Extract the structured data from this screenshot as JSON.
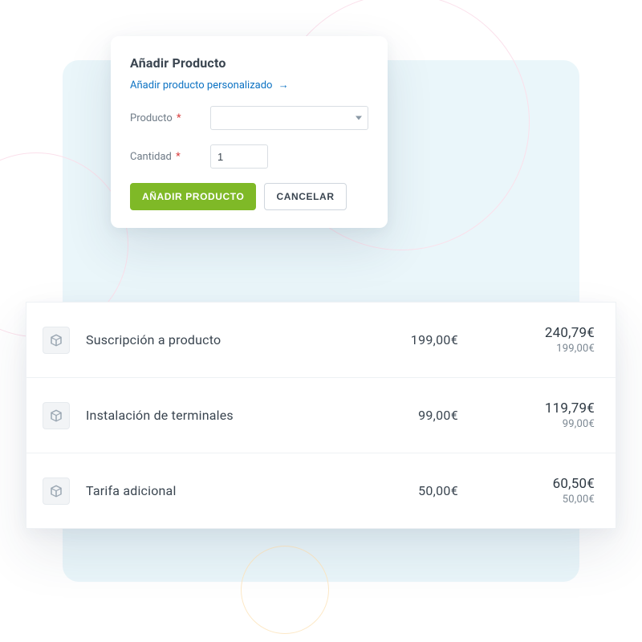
{
  "modal": {
    "title": "Añadir Producto",
    "link_text": "Añadir producto personalizado",
    "link_arrow": "→",
    "product_label": "Producto",
    "quantity_label": "Cantidad",
    "required_mark": "*",
    "product_value": "",
    "quantity_value": "1",
    "submit_label": "Añadir Producto",
    "cancel_label": "Cancelar"
  },
  "products": [
    {
      "name": "Suscripción a producto",
      "unit_price": "199,00€",
      "total": "240,79€",
      "sub": "199,00€"
    },
    {
      "name": "Instalación de terminales",
      "unit_price": "99,00€",
      "total": "119,79€",
      "sub": "99,00€"
    },
    {
      "name": "Tarifa adicional",
      "unit_price": "50,00€",
      "total": "60,50€",
      "sub": "50,00€"
    }
  ]
}
